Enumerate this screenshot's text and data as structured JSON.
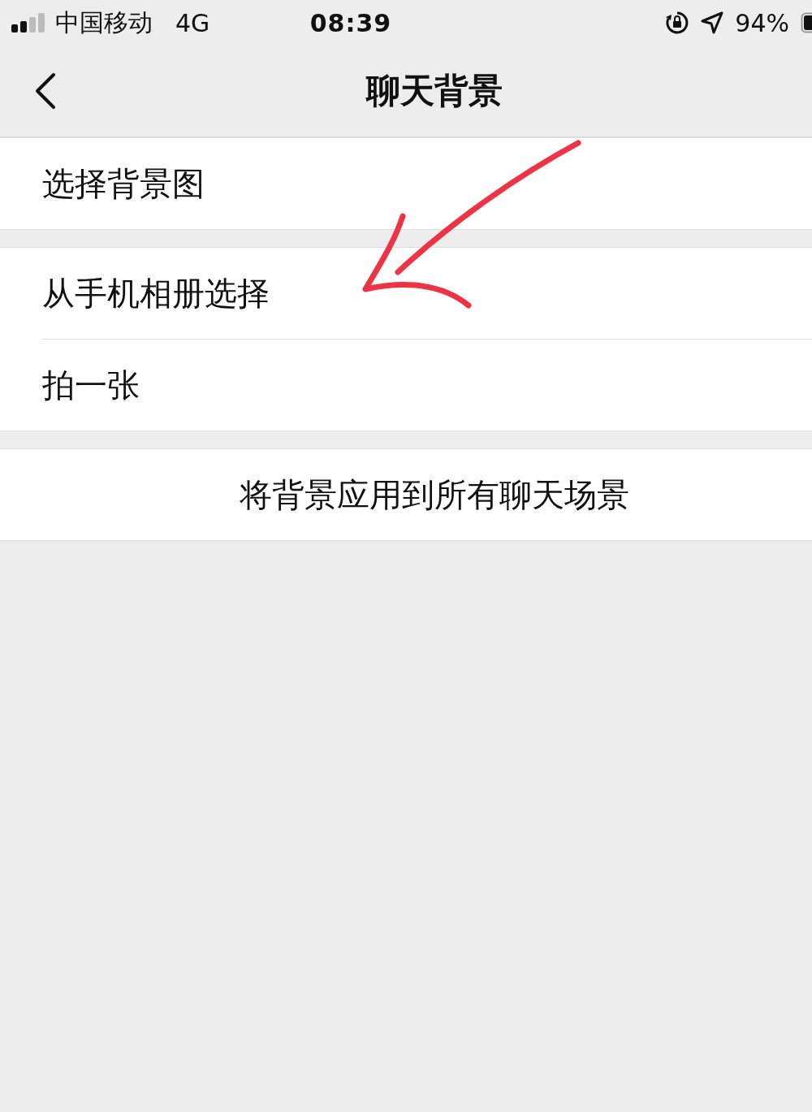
{
  "status_bar": {
    "carrier": "中国移动",
    "network": "4G",
    "time": "08:39",
    "battery": "94%"
  },
  "nav_bar": {
    "title": "聊天背景"
  },
  "sections": [
    {
      "items": [
        {
          "label": "选择背景图",
          "kind": "option"
        }
      ]
    },
    {
      "items": [
        {
          "label": "从手机相册选择",
          "kind": "option"
        },
        {
          "label": "拍一张",
          "kind": "option"
        }
      ]
    },
    {
      "items": [
        {
          "label": "将背景应用到所有聊天场景",
          "kind": "action"
        }
      ]
    }
  ]
}
